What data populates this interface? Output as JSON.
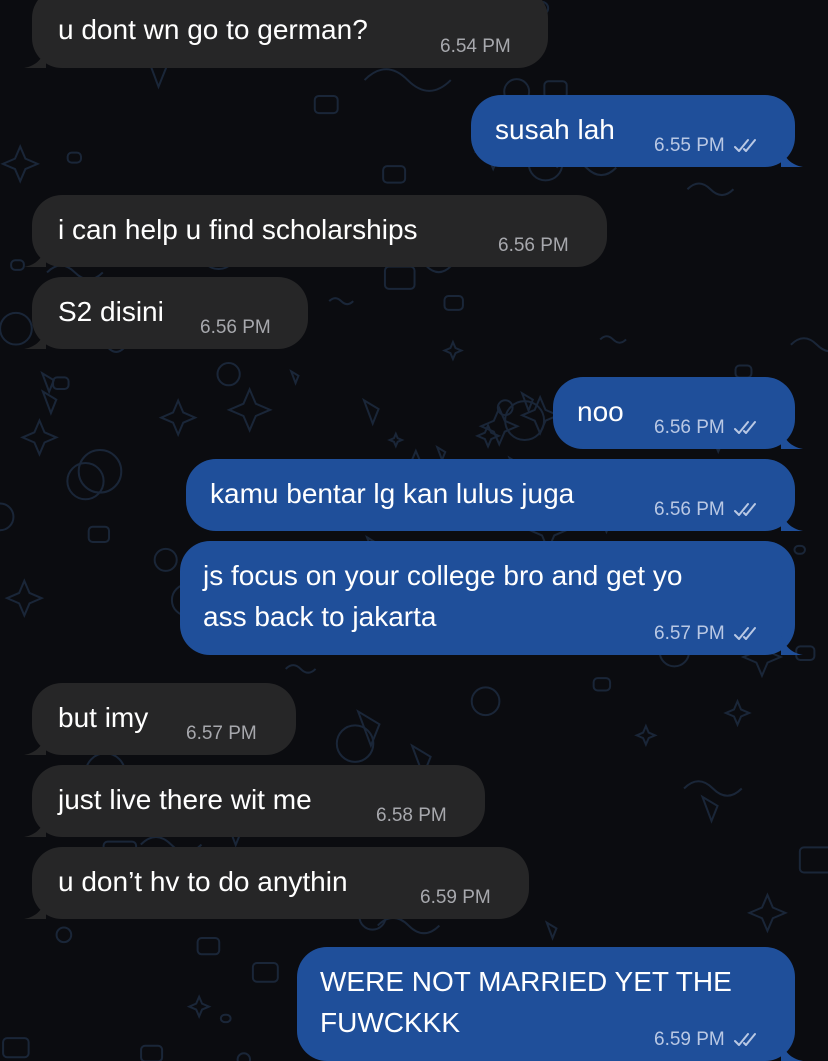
{
  "colors": {
    "background": "#0b0c10",
    "incoming_bubble": "#262627",
    "outgoing_bubble": "#1f4f9a",
    "incoming_time": "#a7a8ad",
    "outgoing_time": "#b9c8e4"
  },
  "messages": [
    {
      "direction": "in",
      "lines": [
        "u dont wn go to german?"
      ],
      "time": "6.54 PM",
      "read_icon": false
    },
    {
      "direction": "out",
      "lines": [
        "susah lah"
      ],
      "time": "6.55 PM",
      "read_icon": "double-check-icon"
    },
    {
      "direction": "in",
      "lines": [
        "i can help u find scholarships"
      ],
      "time": "6.56 PM",
      "read_icon": false
    },
    {
      "direction": "in",
      "lines": [
        "S2 disini"
      ],
      "time": "6.56 PM",
      "read_icon": false
    },
    {
      "direction": "out",
      "lines": [
        "noo"
      ],
      "time": "6.56 PM",
      "read_icon": "double-check-icon"
    },
    {
      "direction": "out",
      "lines": [
        "kamu bentar lg kan lulus juga"
      ],
      "time": "6.56 PM",
      "read_icon": "double-check-icon"
    },
    {
      "direction": "out",
      "lines": [
        "js focus on your college bro and get yo",
        "ass back to jakarta"
      ],
      "time": "6.57 PM",
      "read_icon": "double-check-icon"
    },
    {
      "direction": "in",
      "lines": [
        "but imy"
      ],
      "time": "6.57 PM",
      "read_icon": false
    },
    {
      "direction": "in",
      "lines": [
        "just live there wit me"
      ],
      "time": "6.58 PM",
      "read_icon": false
    },
    {
      "direction": "in",
      "lines": [
        "u don’t hv to do anythin"
      ],
      "time": "6.59 PM",
      "read_icon": false
    },
    {
      "direction": "out",
      "lines": [
        "WERE NOT MARRIED YET THE",
        "FUWCKKK"
      ],
      "time": "6.59 PM",
      "read_icon": "double-check-icon"
    }
  ]
}
